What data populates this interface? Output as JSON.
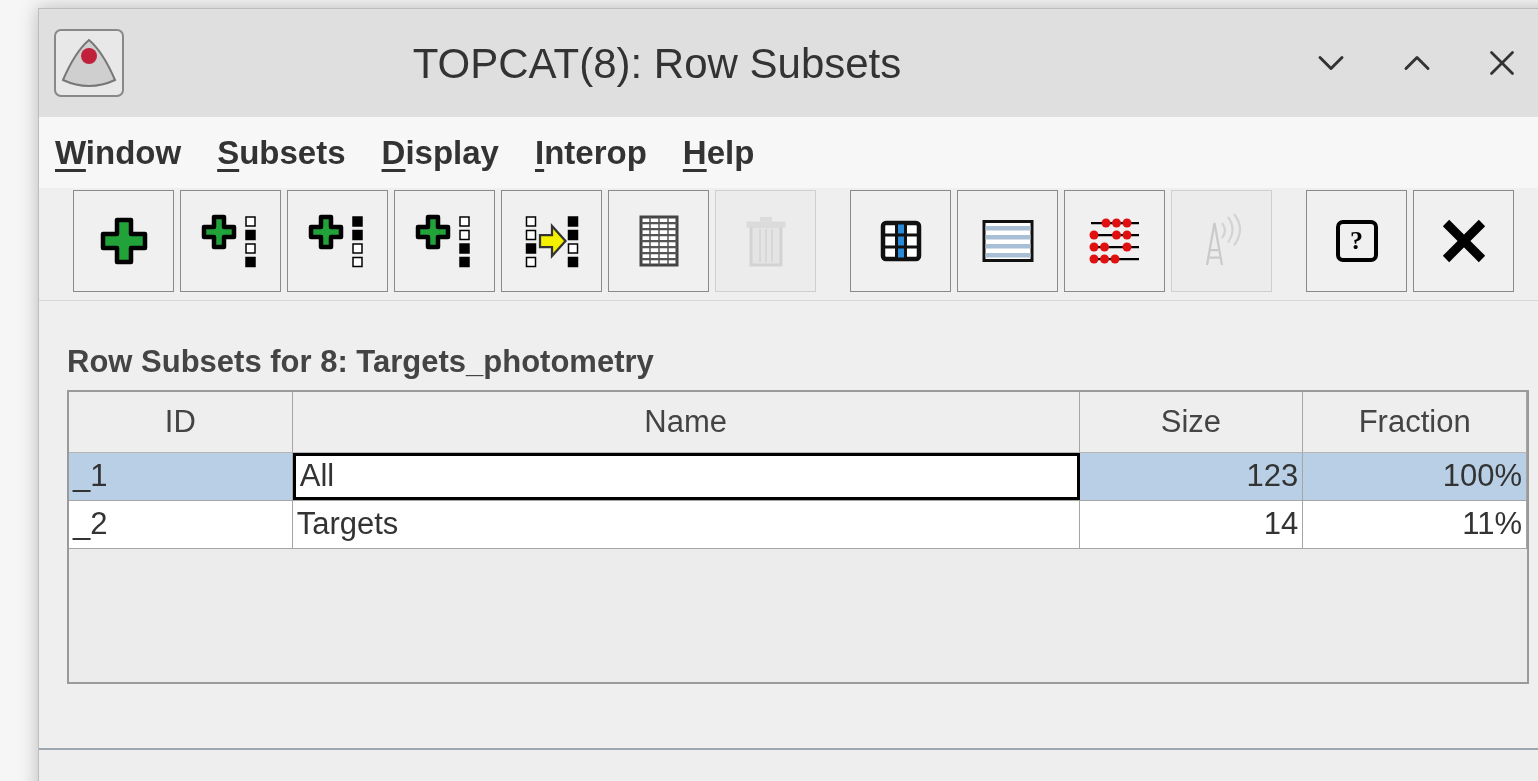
{
  "window": {
    "title": "TOPCAT(8): Row Subsets"
  },
  "menu": [
    {
      "key": "W",
      "rest": "indow"
    },
    {
      "key": "S",
      "rest": "ubsets"
    },
    {
      "key": "D",
      "rest": "isplay"
    },
    {
      "key": "I",
      "rest": "nterop"
    },
    {
      "key": "H",
      "rest": "elp"
    }
  ],
  "toolbar": [
    [
      {
        "kind": "plus",
        "disabled": false
      },
      {
        "kind": "plus-dots-a",
        "disabled": false
      },
      {
        "kind": "plus-dots-b",
        "disabled": false
      },
      {
        "kind": "plus-dots-c",
        "disabled": false
      },
      {
        "kind": "arrow-dots",
        "disabled": false
      },
      {
        "kind": "grid",
        "disabled": false
      },
      {
        "kind": "trash",
        "disabled": true
      }
    ],
    [
      {
        "kind": "columns",
        "disabled": false
      },
      {
        "kind": "rows",
        "disabled": false
      },
      {
        "kind": "abacus",
        "disabled": false
      },
      {
        "kind": "antenna",
        "disabled": true
      }
    ],
    [
      {
        "kind": "help",
        "glyph": "?",
        "disabled": false
      },
      {
        "kind": "close",
        "disabled": false
      }
    ]
  ],
  "panel_title": "Row Subsets for 8: Targets_photometry",
  "table": {
    "columns": [
      {
        "label": "ID",
        "kind": "text"
      },
      {
        "label": "Name",
        "kind": "text"
      },
      {
        "label": "Size",
        "kind": "number"
      },
      {
        "label": "Fraction",
        "kind": "number"
      }
    ],
    "rows": [
      {
        "selected": true,
        "editing_name": true,
        "cells": [
          "_1",
          "All",
          "123",
          "100%"
        ]
      },
      {
        "selected": false,
        "editing_name": false,
        "cells": [
          "_2",
          "Targets",
          "14",
          "11%"
        ]
      }
    ]
  }
}
